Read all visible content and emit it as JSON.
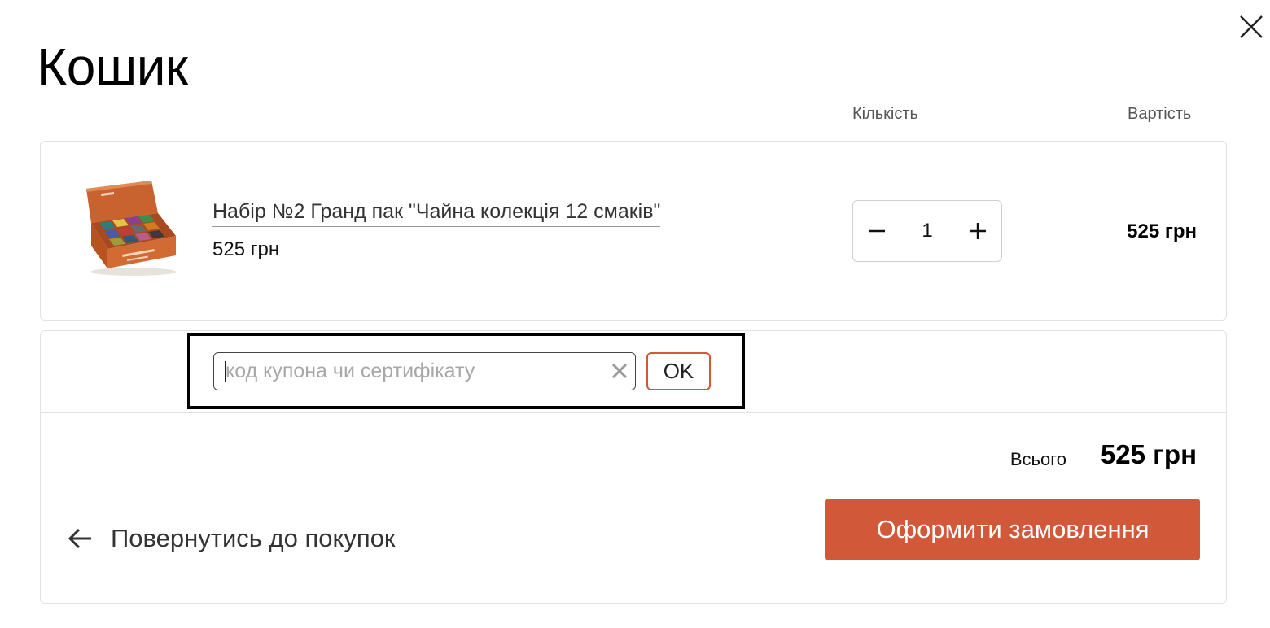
{
  "cart": {
    "title": "Кошик",
    "close_icon": "close-icon",
    "columns": {
      "quantity": "Кількість",
      "cost": "Вартість"
    },
    "items": [
      {
        "title": "Набір №2 Гранд пак \"Чайна колекція 12 смаків\"",
        "price": "525 грн",
        "quantity": "1",
        "line_total": "525 грн",
        "image": "tea-gift-box-image"
      }
    ],
    "coupon": {
      "placeholder": "код купона чи сертифікату",
      "value": "",
      "clear_icon": "clear-x-icon",
      "apply_label": "OK"
    },
    "summary": {
      "total_label": "Всього",
      "total_value": "525 грн"
    },
    "back_link": {
      "label": "Повернутись до покупок",
      "icon": "arrow-left-icon"
    },
    "checkout_label": "Оформити замовлення"
  },
  "colors": {
    "accent": "#d2583a",
    "border": "#e2e2e2",
    "text": "#111111",
    "muted": "#555555"
  }
}
